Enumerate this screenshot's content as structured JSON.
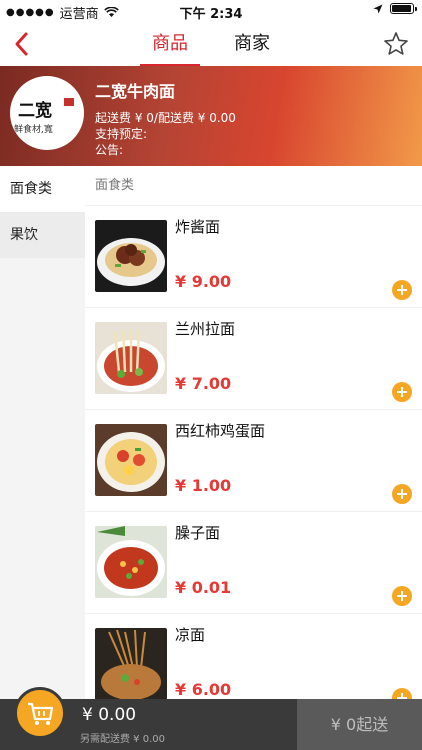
{
  "status_bar": {
    "carrier": "运营商",
    "time": "下午 2:34"
  },
  "nav": {
    "tabs": [
      {
        "label": "商品",
        "active": true
      },
      {
        "label": "商家",
        "active": false
      }
    ],
    "accent_color": "#d7262e"
  },
  "shop": {
    "name": "二宽牛肉面",
    "fees": "起送费 ¥ 0/配送费 ¥ 0.00",
    "preorder": "支持预定:",
    "notice": "公告:",
    "logo_text": "二宽",
    "logo_subtext": "鲜食材,寬"
  },
  "categories": [
    {
      "label": "面食类",
      "active": true
    },
    {
      "label": "果饮",
      "active": false
    }
  ],
  "section_title": "面食类",
  "products": [
    {
      "name": "炸酱面",
      "price": "¥ 9.00"
    },
    {
      "name": "兰州拉面",
      "price": "¥ 7.00"
    },
    {
      "name": "西红柿鸡蛋面",
      "price": "¥ 1.00"
    },
    {
      "name": "臊子面",
      "price": "¥ 0.01"
    },
    {
      "name": "凉面",
      "price": "¥ 6.00"
    }
  ],
  "cart": {
    "total": "¥ 0.00",
    "delivery_note": "另需配送费 ¥ 0.00",
    "checkout_label": "¥ 0起送"
  },
  "colors": {
    "price": "#e53935",
    "add_button": "#f5a623",
    "bottom_bar": "#3a3a3a"
  }
}
